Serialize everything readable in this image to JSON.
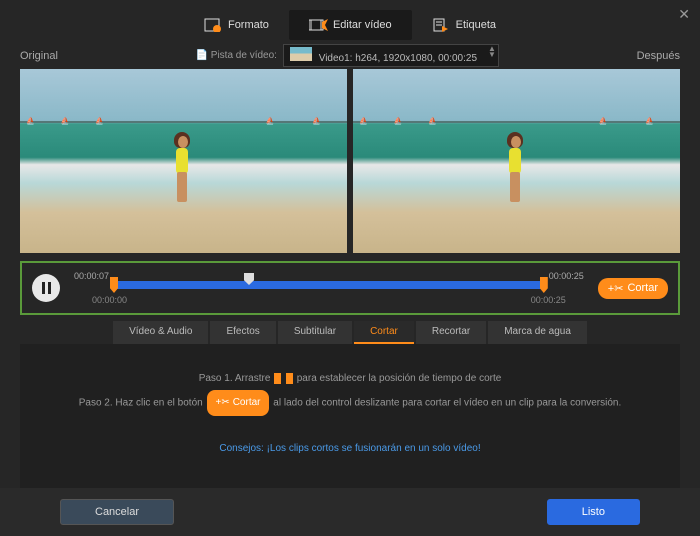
{
  "tabs": {
    "format": "Formato",
    "edit": "Editar vídeo",
    "tag": "Etiqueta"
  },
  "preview": {
    "original": "Original",
    "after": "Después"
  },
  "track": {
    "label": "Pista de vídeo:",
    "value": "Video1: h264, 1920x1080, 00:00:25"
  },
  "timeline": {
    "sel_start": "00:00:07",
    "sel_end": "00:00:25",
    "start": "00:00:00",
    "end": "00:00:25",
    "cut": "Cortar"
  },
  "subtabs": [
    "Vídeo & Audio",
    "Efectos",
    "Subtitular",
    "Cortar",
    "Recortar",
    "Marca de agua"
  ],
  "instructions": {
    "step1a": "Paso 1. Arrastre",
    "step1b": "para establecer la posición de tiempo de corte",
    "step2a": "Paso 2. Haz clic en el botón",
    "step2b": "al lado del control deslizante para cortar el vídeo en un clip para la conversión.",
    "tips": "Consejos: ¡Los clips cortos se fusionarán en un solo vídeo!"
  },
  "footer": {
    "cancel": "Cancelar",
    "ready": "Listo"
  }
}
